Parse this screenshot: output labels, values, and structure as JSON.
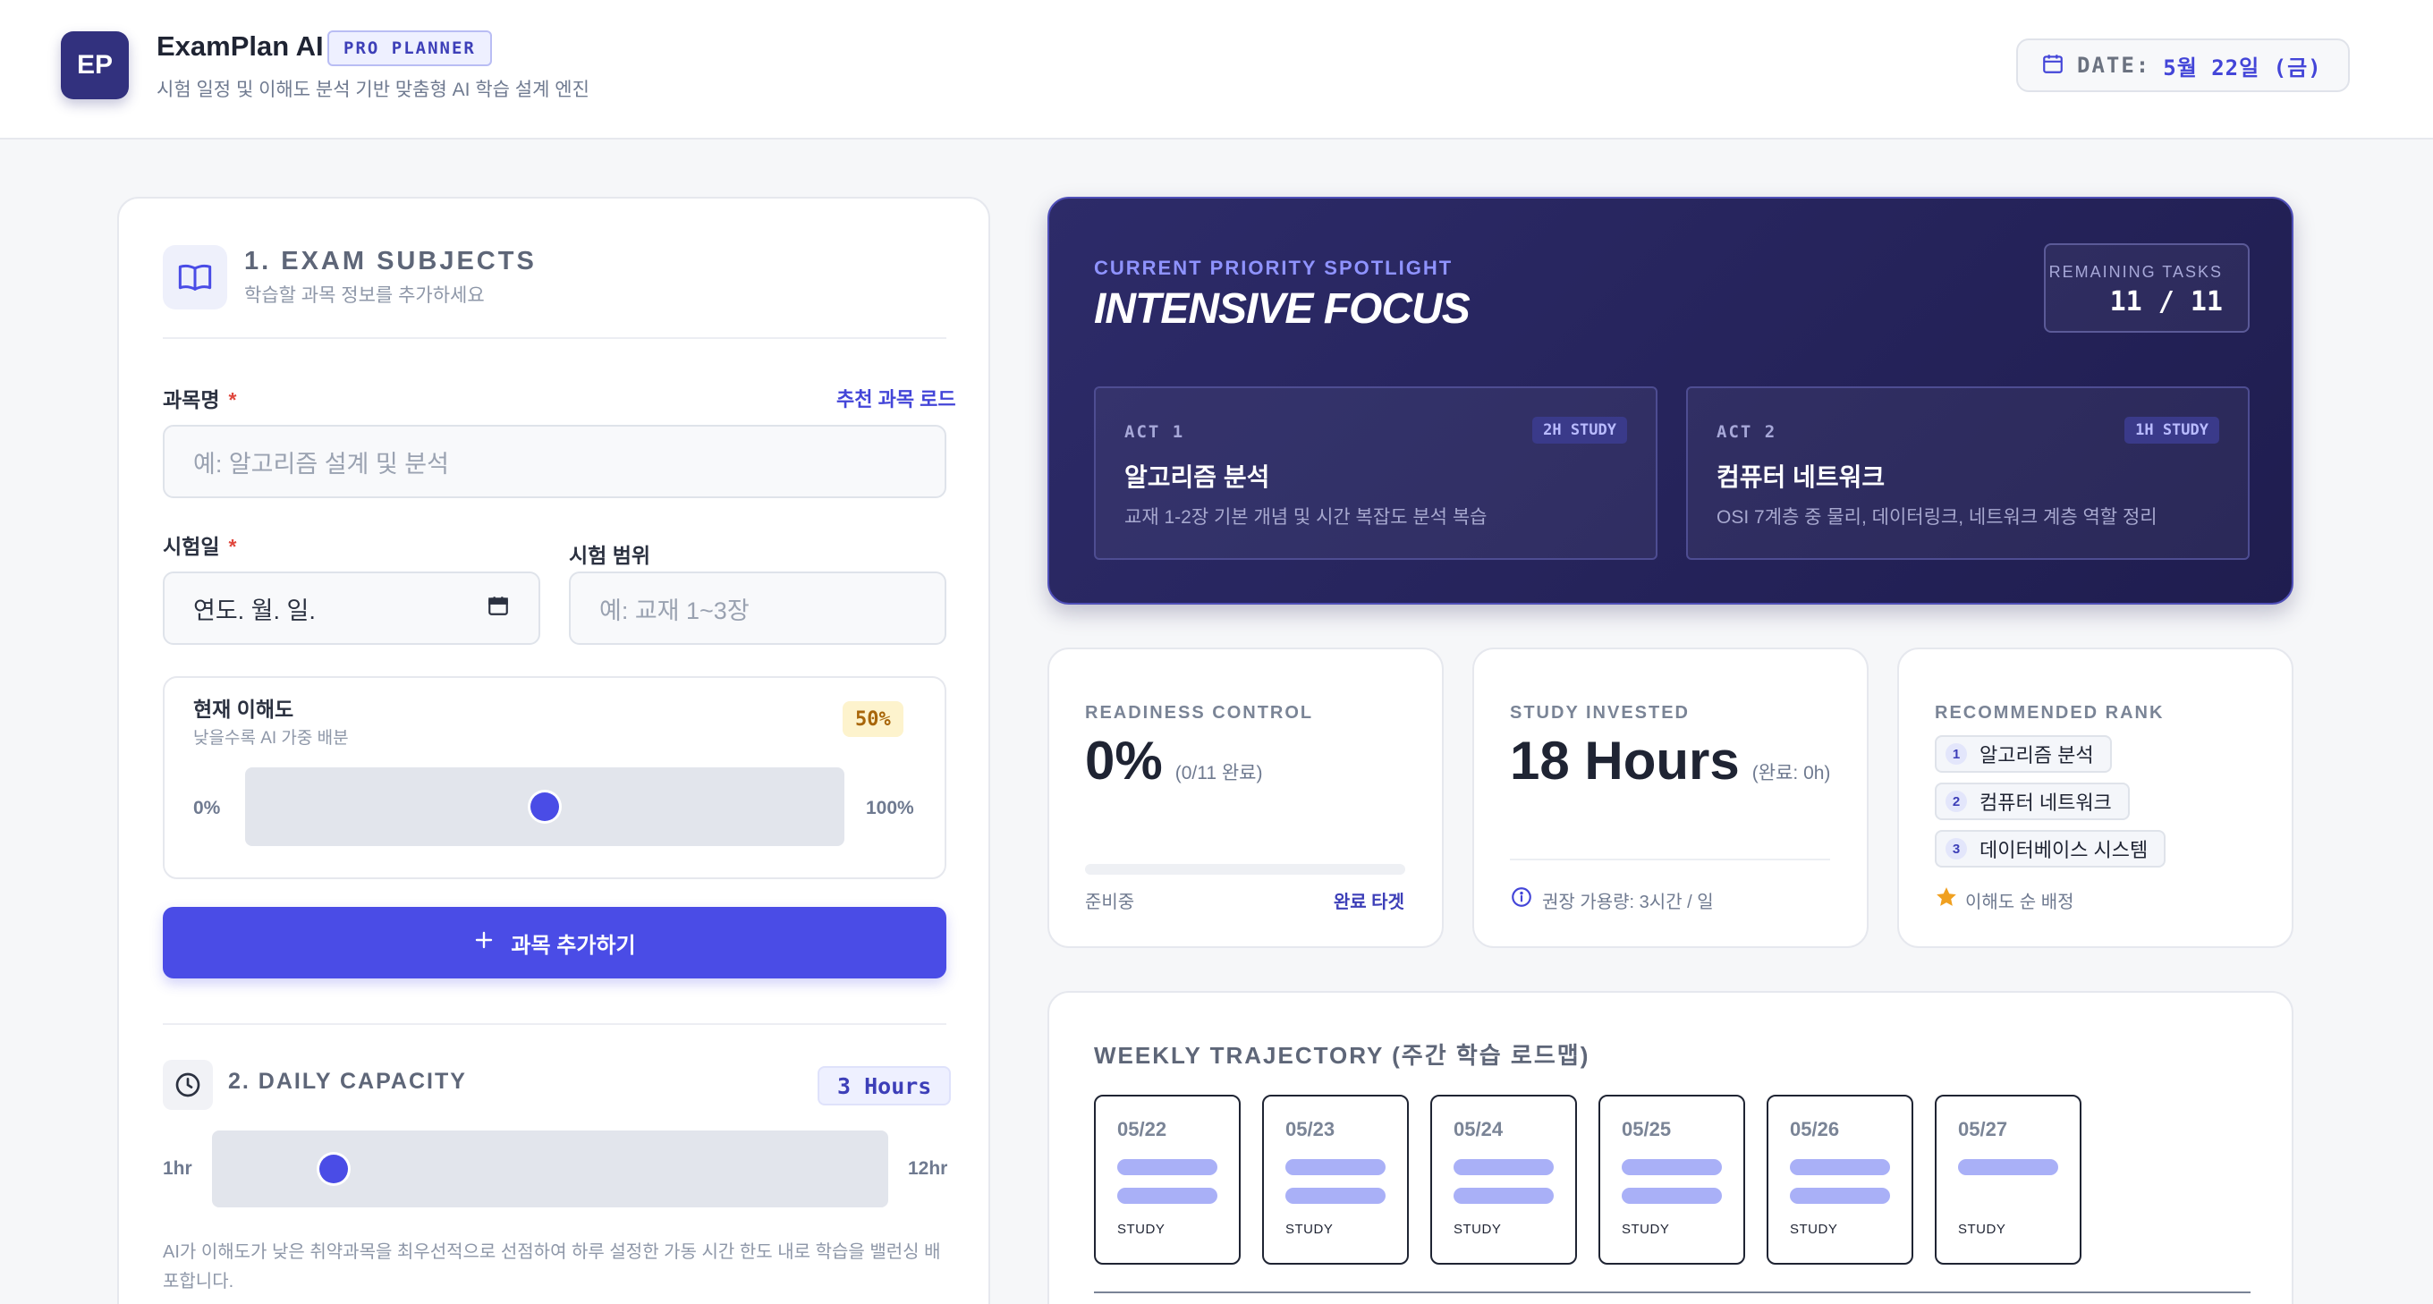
{
  "header": {
    "logo_text": "EP",
    "app_title": "ExamPlan AI",
    "badge": "PRO PLANNER",
    "subtitle": "시험 일정 및 이해도 분석 기반 맞춤형 AI 학습 설계 엔진",
    "date_label": "DATE:",
    "date_value": "5월 22일 (금)",
    "date_icon": "calendar-icon"
  },
  "subjects": {
    "title": "1. EXAM SUBJECTS",
    "subtitle": "학습할 과목 정보를 추가하세요",
    "icon": "book-icon",
    "name_label": "과목명",
    "required_mark": "*",
    "load_link": "추천 과목 로드",
    "name_placeholder": "예: 알고리즘 설계 및 분석",
    "date_label": "시험일",
    "date_value": "연도. 월. 일.",
    "range_label": "시험 범위",
    "range_placeholder": "예: 교재 1~3장",
    "understanding_label": "현재 이해도",
    "understanding_hint": "낮을수록 AI 가중 배분",
    "understanding_value": "50%",
    "understanding_fraction": 0.5,
    "min_label": "0%",
    "max_label": "100%",
    "add_button": "과목 추가하기"
  },
  "capacity": {
    "title": "2. DAILY CAPACITY",
    "icon": "clock-icon",
    "badge": "3 Hours",
    "min_label": "1hr",
    "max_label": "12hr",
    "fraction": 0.18,
    "note": "AI가 이해도가 낮은 취약과목을 최우선적으로 선점하여 하루 설정한 가동 시간 한도 내로 학습을 밸런싱 배포합니다."
  },
  "spotlight": {
    "eyebrow": "CURRENT PRIORITY SPOTLIGHT",
    "title": "INTENSIVE FOCUS",
    "remaining_label": "REMAINING TASKS",
    "remaining_value": "11 / 11",
    "acts": [
      {
        "label": "ACT 1",
        "badge": "2H STUDY",
        "title": "알고리즘 분석",
        "desc": "교재 1-2장 기본 개념 및 시간 복잡도 분석 복습"
      },
      {
        "label": "ACT 2",
        "badge": "1H STUDY",
        "title": "컴퓨터 네트워크",
        "desc": "OSI 7계층 중 물리, 데이터링크, 네트워크 계층 역할 정리"
      }
    ]
  },
  "stats": {
    "readiness": {
      "label": "READINESS CONTROL",
      "value": "0%",
      "detail": "(0/11 완료)",
      "progress": 0,
      "foot_left": "준비중",
      "foot_right": "완료 타겟"
    },
    "invested": {
      "label": "STUDY INVESTED",
      "value": "18 Hours",
      "detail": "(완료: 0h)",
      "foot": "권장 가용량: 3시간 / 일",
      "foot_icon": "info-icon"
    },
    "rank": {
      "label": "RECOMMENDED RANK",
      "items": [
        {
          "n": "1",
          "name": "알고리즘 분석"
        },
        {
          "n": "2",
          "name": "컴퓨터 네트워크"
        },
        {
          "n": "3",
          "name": "데이터베이스 시스템"
        }
      ],
      "foot": "이해도 순 배정",
      "foot_icon": "star-icon",
      "foot_icon_color": "#f0a020"
    }
  },
  "weekly": {
    "title": "WEEKLY TRAJECTORY (주간 학습 로드맵)",
    "days": [
      {
        "date": "05/22",
        "tag": "STUDY",
        "bars": 2
      },
      {
        "date": "05/23",
        "tag": "STUDY",
        "bars": 2
      },
      {
        "date": "05/24",
        "tag": "STUDY",
        "bars": 2
      },
      {
        "date": "05/25",
        "tag": "STUDY",
        "bars": 2
      },
      {
        "date": "05/26",
        "tag": "STUDY",
        "bars": 2
      },
      {
        "date": "05/27",
        "tag": "STUDY",
        "bars": 1
      }
    ]
  },
  "colors": {
    "accent": "#4a4ce6",
    "spotlight_bg": "#2d2b69",
    "pct_badge_bg": "#fdf3cd"
  }
}
